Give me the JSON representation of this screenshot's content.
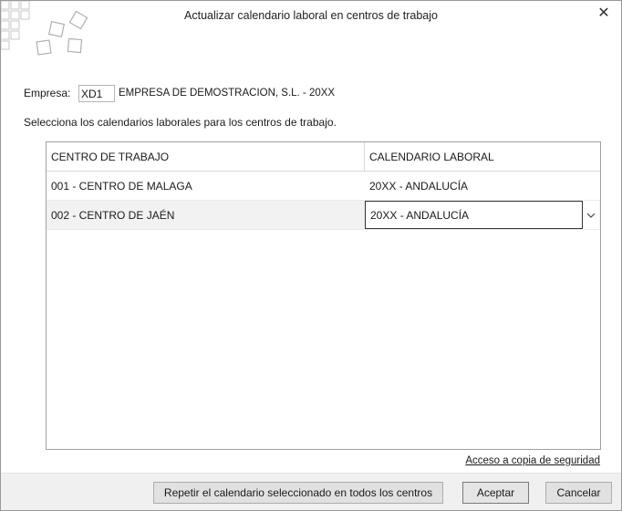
{
  "window": {
    "title": "Actualizar calendario laboral en centros de trabajo",
    "close_label": "✕"
  },
  "empresa": {
    "label": "Empresa:",
    "code": "XD1",
    "name": "EMPRESA DE DEMOSTRACION, S.L. - 20XX"
  },
  "instruction": "Selecciona los calendarios laborales para los centros de trabajo.",
  "grid": {
    "columns": [
      "CENTRO DE TRABAJO",
      "CALENDARIO LABORAL"
    ],
    "rows": [
      {
        "centro": "001 - CENTRO DE MALAGA",
        "calendario": "20XX - ANDALUCÍA",
        "editing": false
      },
      {
        "centro": "002 - CENTRO DE JAÉN",
        "calendario": "20XX - ANDALUCÍA",
        "editing": true
      }
    ]
  },
  "link_backup": "Acceso a copia de seguridad",
  "buttons": {
    "repeat": "Repetir el calendario seleccionado en todos los centros",
    "accept": "Aceptar",
    "cancel": "Cancelar"
  },
  "icons": {
    "close": "close-icon",
    "dropdown": "chevron-down-icon",
    "logo": "diamond-squares-logo"
  }
}
